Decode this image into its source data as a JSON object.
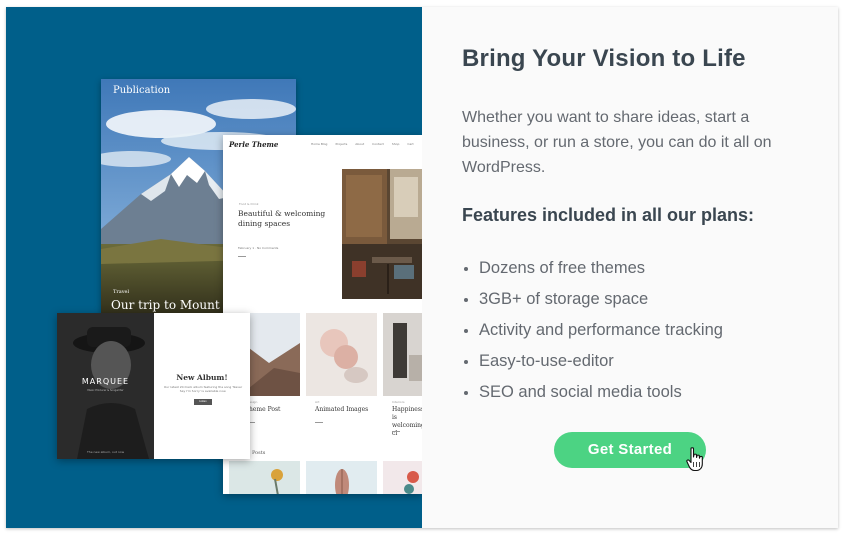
{
  "colors": {
    "panel_blue": "#005f8a",
    "button_green": "#4cd383",
    "heading_text": "#3a4650",
    "body_text": "#646970"
  },
  "mockups": {
    "publication": {
      "site_title": "Publication",
      "tag": "Travel",
      "caption": "Our trip to Mount"
    },
    "perle": {
      "logo": "Perle Theme",
      "nav": [
        "Home Blog",
        "Projects",
        "About",
        "Contact",
        "Shop",
        "Cart"
      ],
      "section": "Food & Drink",
      "heading": "Beautiful & welcoming dining spaces",
      "meta": "February 1 · No Comments",
      "posts": [
        {
          "section": "Design",
          "title": "Theme Post"
        },
        {
          "section": "Art",
          "title": "Animated Images"
        },
        {
          "section": "Interiors",
          "title": "Happiness is welcoming cl"
        }
      ],
      "recent_label": "Posts"
    },
    "marquee": {
      "wordmark": "MARQUEE",
      "tagline": "Music Producer & Songwriter",
      "bottom": "The new album, out now",
      "album_title": "New Album!",
      "album_desc": "Our latest 20-track album featuring the song 'Never Say I'm Sorry' is available now.",
      "button": "Listen"
    }
  },
  "content": {
    "headline": "Bring Your Vision to Life",
    "description": "Whether you want to share ideas, start a business, or run a store, you can do it all on WordPress.",
    "features_heading": "Features included in all our plans:",
    "features": [
      "Dozens of free themes",
      "3GB+ of storage space",
      "Activity and performance tracking",
      "Easy-to-use-editor",
      "SEO and social media tools"
    ],
    "cta_label": "Get Started"
  }
}
